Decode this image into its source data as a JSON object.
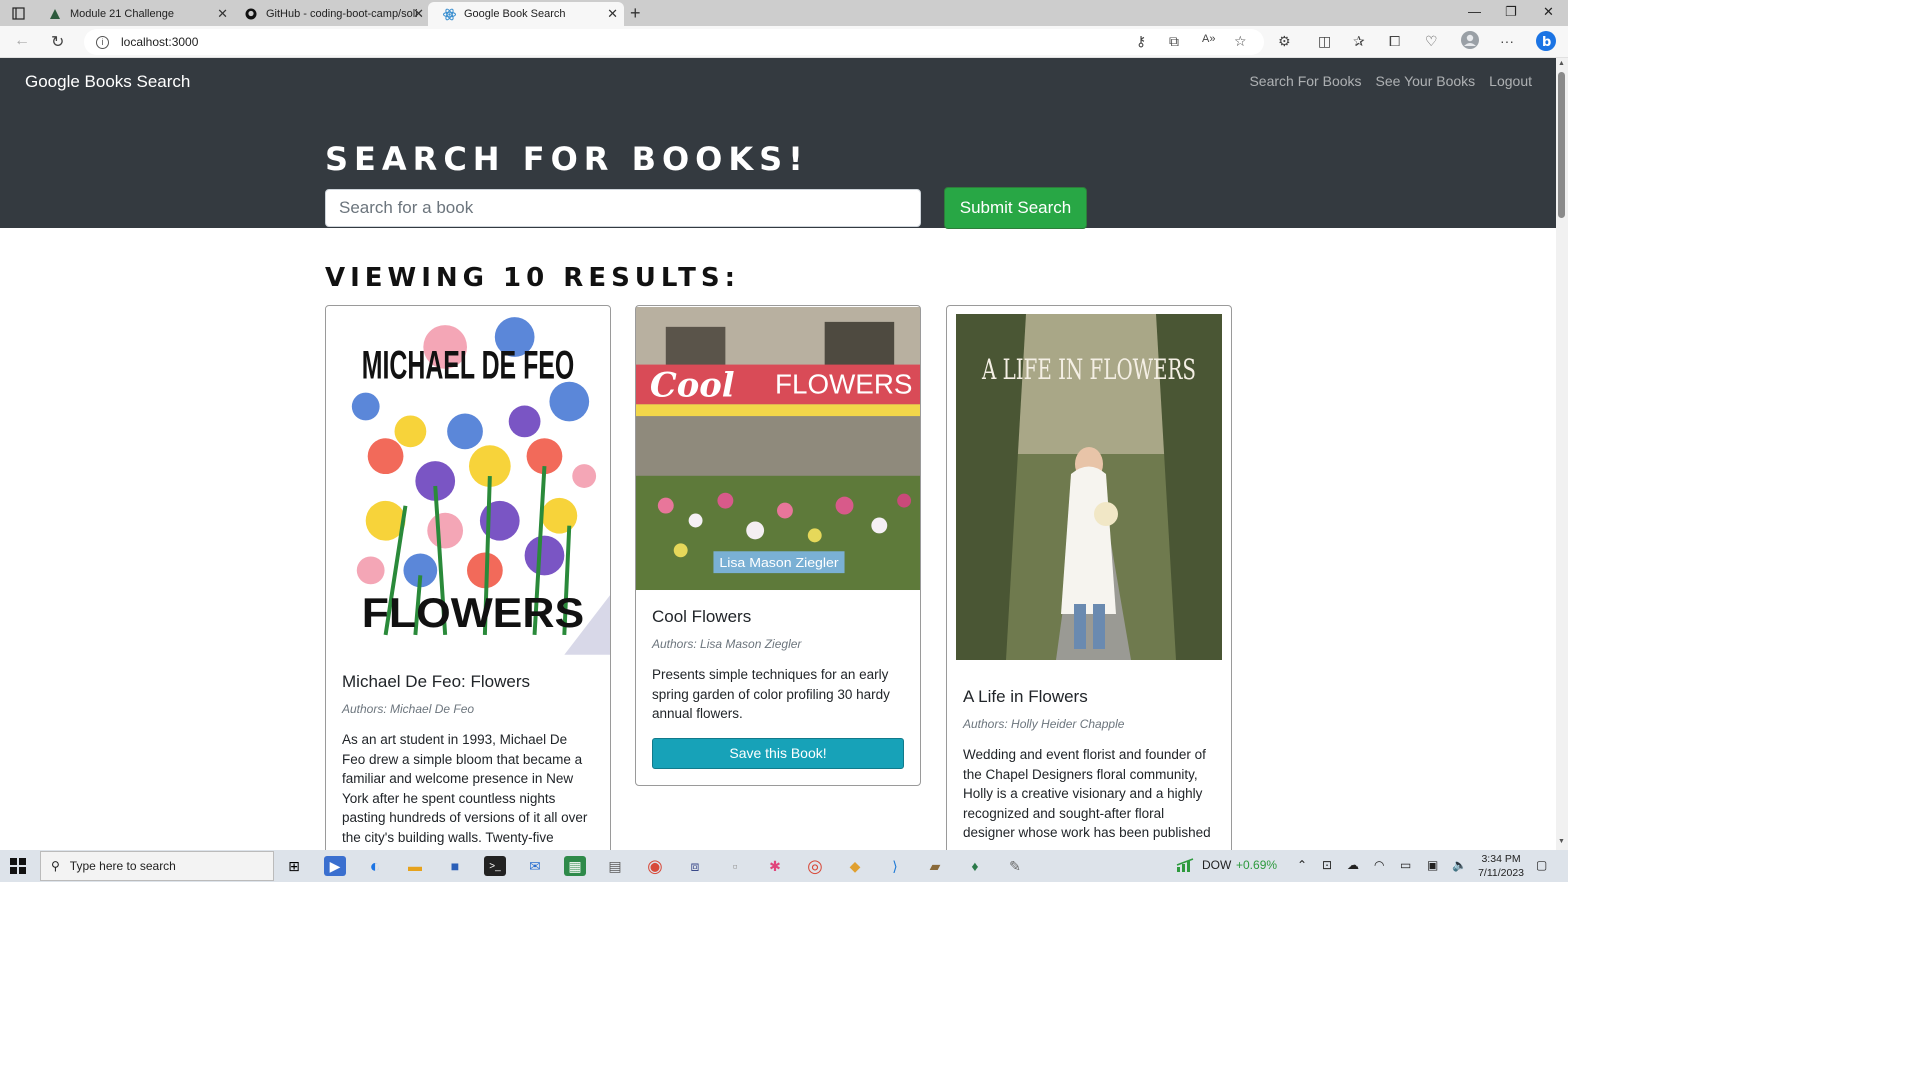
{
  "browser": {
    "tabs": [
      {
        "title": "Module 21 Challenge",
        "icon": "bootcamp-icon"
      },
      {
        "title": "GitHub - coding-boot-camp/soli",
        "icon": "github-icon"
      },
      {
        "title": "Google Book Search",
        "icon": "react-icon"
      }
    ],
    "url": "localhost:3000"
  },
  "app": {
    "brand": "Google Books Search",
    "nav": {
      "search": "Search For Books",
      "saved": "See Your Books",
      "logout": "Logout"
    },
    "hero_title": "Search for Books!",
    "search": {
      "placeholder": "Search for a book",
      "value": ""
    },
    "submit_label": "Submit Search",
    "results_title": "Viewing 10 results:",
    "books": [
      {
        "title": "Michael De Feo: Flowers",
        "authors": "Authors: Michael De Feo",
        "description": "As an art student in 1993, Michael De Feo drew a simple bloom that became a familiar and welcome presence in New York after he spent countless nights pasting hundreds of versions of it all over the city's building walls. Twenty-five",
        "cover_text_top": "MICHAEL DE FEO",
        "cover_text_bottom": "FLOWERS"
      },
      {
        "title": "Cool Flowers",
        "authors": "Authors: Lisa Mason Ziegler",
        "description": "Presents simple techniques for an early spring garden of color profiling 30 hardy annual flowers.",
        "save_label": "Save this Book!",
        "cover_title_a": "Cool",
        "cover_title_b": "FLOWERS",
        "cover_author": "Lisa Mason Ziegler"
      },
      {
        "title": "A Life in Flowers",
        "authors": "Authors: Holly Heider Chapple",
        "description": "Wedding and event florist and founder of the Chapel Designers floral community, Holly is a creative visionary and a highly recognized and sought-after floral designer whose work has been published",
        "cover_title": "A LIFE IN FLOWERS"
      }
    ]
  },
  "taskbar": {
    "search_placeholder": "Type here to search",
    "stock_label": "DOW",
    "stock_change": "+0.69%",
    "time": "3:34 PM",
    "date": "7/11/2023"
  },
  "colors": {
    "header_bg": "#343a40",
    "submit": "#28a745",
    "save": "#17a2b8",
    "stock_up": "#2e9a3e"
  }
}
